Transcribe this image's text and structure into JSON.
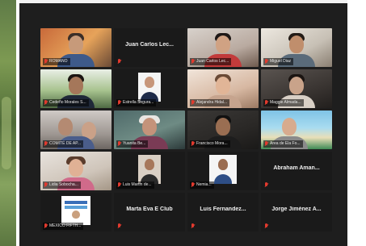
{
  "colors": {
    "window_bg": "#1e1e1e",
    "tile_bg": "#1a1a1a",
    "active_border": "#b6cf3a",
    "muted_icon": "#e23a2e"
  },
  "participants": [
    {
      "name": "ROMANO",
      "video": true
    },
    {
      "name": "Juan Carlos Lec...",
      "video": false
    },
    {
      "name": "Juan Carlos Lec...",
      "video": true
    },
    {
      "name": "Miguel Diaz",
      "video": true
    },
    {
      "name": "",
      "video": false
    },
    {
      "name": "Cedeño Morales S...",
      "video": true,
      "active": true
    },
    {
      "name": "Estrella Segura...",
      "video": true
    },
    {
      "name": "Alejandra Hidal...",
      "video": true
    },
    {
      "name": "Maggie Almada...",
      "video": true
    },
    {
      "name": "",
      "video": false
    },
    {
      "name": "COMITÉ DE AP...",
      "video": true
    },
    {
      "name": "Yuanita Be...",
      "video": true
    },
    {
      "name": "Francisco Mora...",
      "video": true
    },
    {
      "name": "Area de Ela Fo...",
      "video": true
    },
    {
      "name": "",
      "video": false
    },
    {
      "name": "Lidia Sobocha...",
      "video": true
    },
    {
      "name": "Luis Martin de...",
      "video": true
    },
    {
      "name": "Nemia...",
      "video": true
    },
    {
      "name": "Abraham Aman...",
      "video": false
    },
    {
      "name": "",
      "video": false
    },
    {
      "name": "MEXICO FIFTH...",
      "video": true
    },
    {
      "name": "Marta Eva E Club",
      "video": false
    },
    {
      "name": "Luis  Fernandez...",
      "video": false
    },
    {
      "name": "Jorge Jiménez A...",
      "video": false
    },
    {
      "name": "",
      "video": false
    }
  ]
}
